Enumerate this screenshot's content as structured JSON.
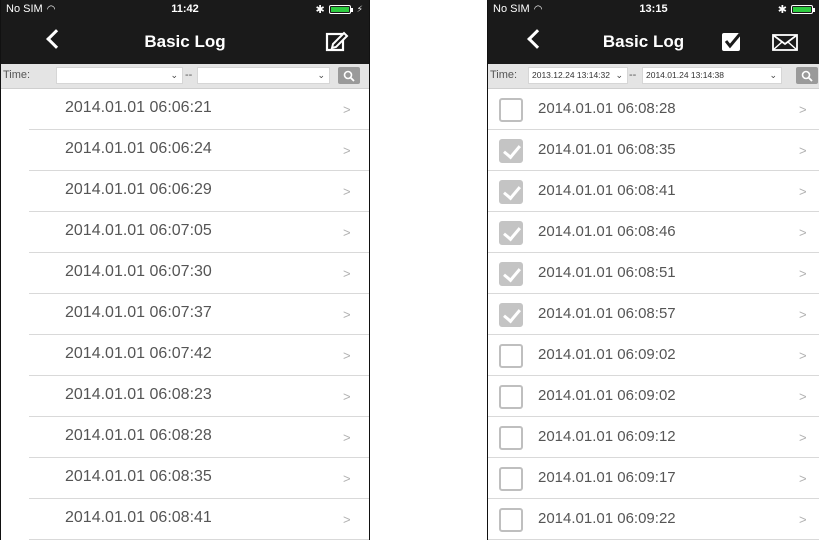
{
  "left": {
    "status": {
      "carrier": "No SIM",
      "time": "11:42"
    },
    "nav": {
      "title": "Basic Log"
    },
    "filter": {
      "label": "Time:",
      "start": "",
      "separator": "--",
      "end": ""
    },
    "rows": [
      "2014.01.01 06:06:21",
      "2014.01.01 06:06:24",
      "2014.01.01 06:06:29",
      "2014.01.01 06:07:05",
      "2014.01.01 06:07:30",
      "2014.01.01 06:07:37",
      "2014.01.01 06:07:42",
      "2014.01.01 06:08:23",
      "2014.01.01 06:08:28",
      "2014.01.01 06:08:35",
      "2014.01.01 06:08:41"
    ]
  },
  "right": {
    "status": {
      "carrier": "No SIM",
      "time": "13:15"
    },
    "nav": {
      "title": "Basic Log"
    },
    "filter": {
      "label": "Time:",
      "start": "2013.12.24 13:14:32",
      "separator": "--",
      "end": "2014.01.24 13:14:38"
    },
    "rows": [
      {
        "date": "2014.01.01 06:08:28",
        "checked": false
      },
      {
        "date": "2014.01.01 06:08:35",
        "checked": true
      },
      {
        "date": "2014.01.01 06:08:41",
        "checked": true
      },
      {
        "date": "2014.01.01 06:08:46",
        "checked": true
      },
      {
        "date": "2014.01.01 06:08:51",
        "checked": true
      },
      {
        "date": "2014.01.01 06:08:57",
        "checked": true
      },
      {
        "date": "2014.01.01 06:09:02",
        "checked": false
      },
      {
        "date": "2014.01.01 06:09:02",
        "checked": false
      },
      {
        "date": "2014.01.01 06:09:12",
        "checked": false
      },
      {
        "date": "2014.01.01 06:09:17",
        "checked": false
      },
      {
        "date": "2014.01.01 06:09:22",
        "checked": false
      }
    ]
  },
  "icons": {
    "back": "back-chevron-icon",
    "edit": "edit-pencil-icon",
    "select_all": "checkbox-icon",
    "mail": "mail-envelope-icon",
    "search": "search-icon",
    "row_chevron": "chevron-right-icon",
    "wifi": "wifi-icon",
    "bluetooth": "bluetooth-icon",
    "battery": "battery-icon"
  },
  "colors": {
    "navbar": "#1a1a1a",
    "filterbar": "#e4e4e4",
    "battery": "#2ecc40",
    "checked_box": "#c4c4c4"
  }
}
